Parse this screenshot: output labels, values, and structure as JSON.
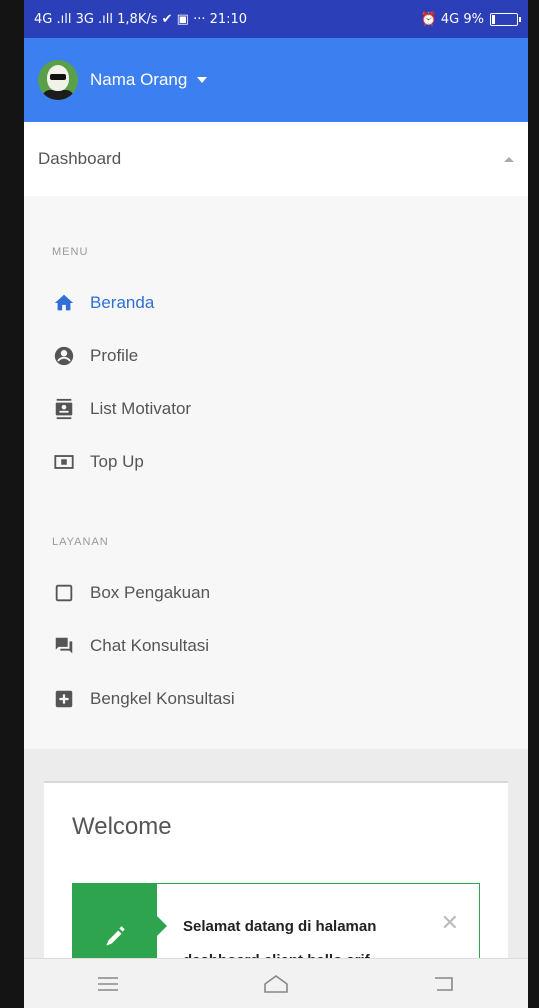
{
  "status": {
    "left": "4G .ıll 3G .ıll 1,8K/s ✔ ▣ ··· 21:10",
    "right": "⏰ 4G 9%"
  },
  "header": {
    "username": "Nama Orang"
  },
  "dashboard": {
    "label": "Dashboard"
  },
  "menu": {
    "heading": "MENU",
    "items": [
      {
        "label": "Beranda",
        "icon": "home-icon"
      },
      {
        "label": "Profile",
        "icon": "account-circle-icon"
      },
      {
        "label": "List Motivator",
        "icon": "contacts-icon"
      },
      {
        "label": "Top Up",
        "icon": "money-icon"
      }
    ]
  },
  "layanan": {
    "heading": "LAYANAN",
    "items": [
      {
        "label": "Box Pengakuan",
        "icon": "checkbox-icon"
      },
      {
        "label": "Chat Konsultasi",
        "icon": "chat-icon"
      },
      {
        "label": "Bengkel Konsultasi",
        "icon": "box-plus-icon"
      }
    ]
  },
  "card": {
    "title": "Welcome",
    "alert_text": "Selamat datang di halaman dashboard client hallo arif",
    "close": "✕"
  },
  "colors": {
    "statusbar": "#2b3fb8",
    "appbar": "#3c7ff0",
    "active": "#2f6fd6",
    "success": "#2ea44f"
  }
}
